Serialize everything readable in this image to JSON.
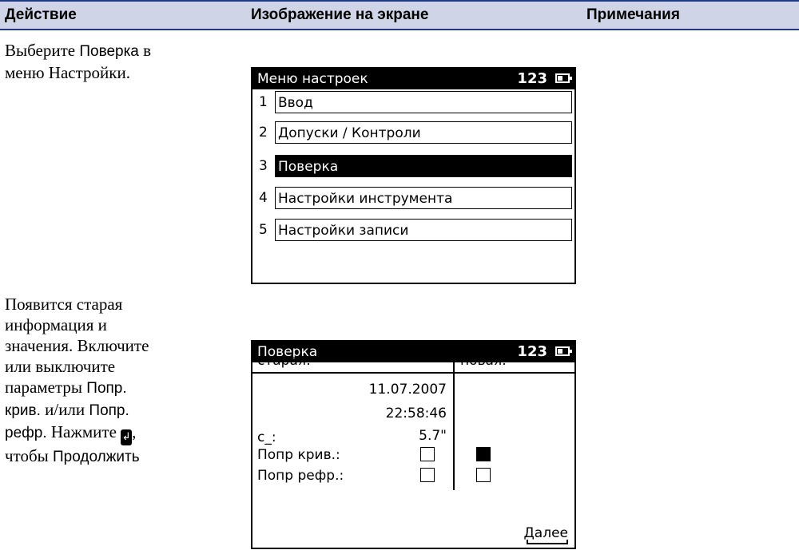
{
  "header": {
    "col1": "Действие",
    "col2": "Изображение на экране",
    "col3": "Примечания"
  },
  "step1": {
    "text_a": "Выберите ",
    "text_b": "Поверка",
    "text_c": " в",
    "text_d": "меню Настройки."
  },
  "screen1": {
    "title": "Меню настроек",
    "code": "123",
    "items": [
      {
        "num": "1",
        "label": "Ввод"
      },
      {
        "num": "2",
        "label": "Допуски / Контроли"
      },
      {
        "num": "3",
        "label": "Поверка",
        "selected": true
      },
      {
        "num": "4",
        "label": "Настройки инструмента"
      },
      {
        "num": "5",
        "label": "Настройки записи"
      }
    ]
  },
  "step2": {
    "line1": "Появится старая",
    "line2": "информация и",
    "line3": "значения. Включите",
    "line4": "или выключите",
    "line5a": "параметры ",
    "line5b": "Попр.",
    "line6a": "крив.",
    "line6b": " и/или ",
    "line6c": "Попр.",
    "line7a": "рефр.",
    "line7b": " Нажмите ",
    "enter_glyph": "↲",
    "line7c": ",",
    "line8a": "чтобы ",
    "line8b": "Продолжить"
  },
  "screen2": {
    "title": "Поверка",
    "code": "123",
    "col_old": "старая:",
    "col_new": "новая:",
    "date": "11.07.2007",
    "time": "22:58:46",
    "c_label": "c_:",
    "c_value": "5.7\"",
    "curv_label": "Попр крив.:",
    "refr_label": "Попр рефр.:",
    "curv_old": false,
    "curv_new": true,
    "refr_old": false,
    "refr_new": false,
    "softkey": "Далее"
  }
}
